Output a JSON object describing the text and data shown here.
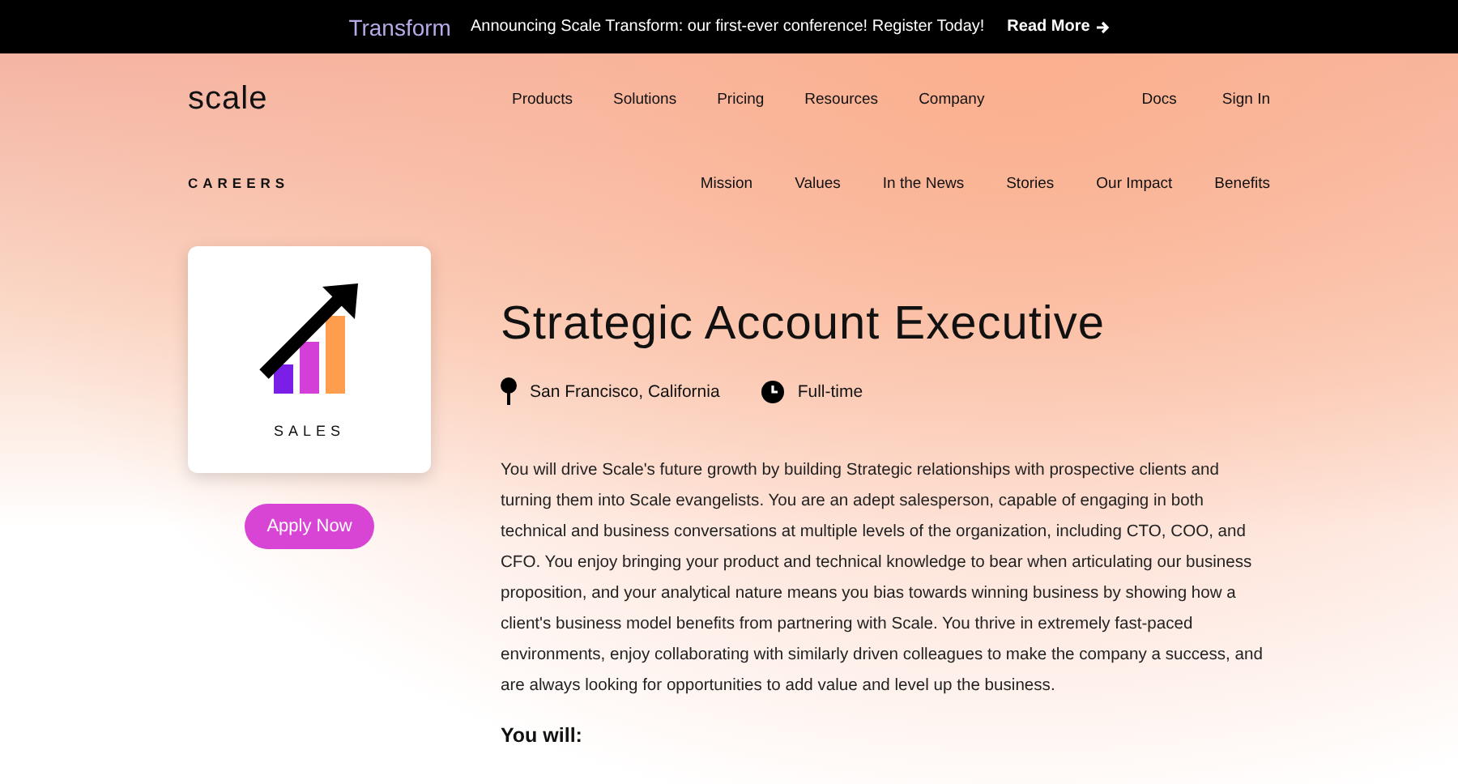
{
  "banner": {
    "brand": "Transform",
    "message": "Announcing Scale Transform: our first-ever conference! Register Today!",
    "link": "Read More"
  },
  "nav": {
    "logo": "scale",
    "items": [
      "Products",
      "Solutions",
      "Pricing",
      "Resources",
      "Company"
    ],
    "right": [
      "Docs",
      "Sign In"
    ]
  },
  "subnav": {
    "title": "CAREERS",
    "items": [
      "Mission",
      "Values",
      "In the News",
      "Stories",
      "Our Impact",
      "Benefits"
    ]
  },
  "card": {
    "label": "SALES"
  },
  "apply": "Apply Now",
  "job": {
    "title": "Strategic Account Executive",
    "location": "San Francisco, California",
    "type": "Full-time",
    "description": "You will drive Scale's future growth by building Strategic relationships with prospective clients and turning them into Scale evangelists. You are an adept salesperson, capable of engaging in both technical and business conversations at multiple levels of the organization, including CTO, COO, and CFO. You enjoy bringing your product and technical knowledge to bear when articulating our business proposition, and your analytical nature means you bias towards winning business by showing how a client's business model benefits from partnering with Scale. You thrive in extremely fast-paced environments, enjoy collaborating with similarly driven colleagues to make the company a success, and are always looking for opportunities to add value and level up the business.",
    "section": "You will:"
  }
}
